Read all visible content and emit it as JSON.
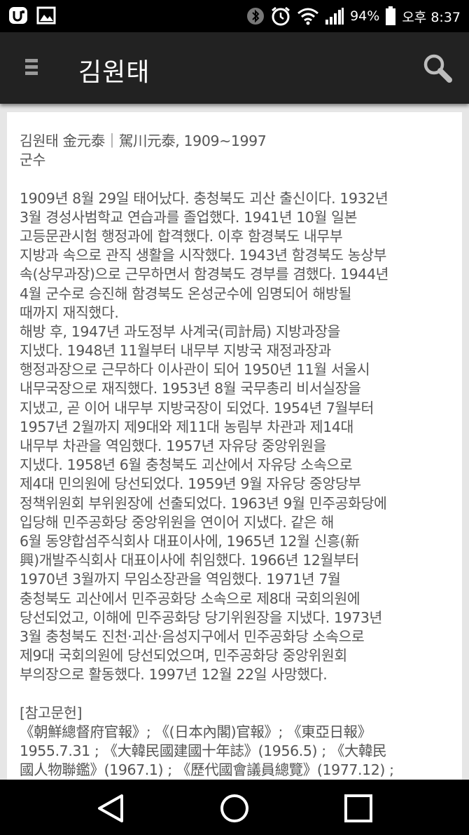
{
  "status_bar": {
    "battery": "94%",
    "time": "오후 8:37",
    "icons": [
      "u-plus-icon",
      "gallery-icon",
      "bluetooth-icon",
      "alarm-icon",
      "wifi-icon",
      "signal-icon",
      "battery-icon"
    ]
  },
  "app_bar": {
    "title": "김원태",
    "menu_icon": "hamburger-menu-icon",
    "search_icon": "search-icon"
  },
  "article": {
    "lines": [
      "김원태 金元泰｜駕川元泰, 1909~1997",
      "군수",
      "",
      "1909년 8월 29일 태어났다. 충청북도 괴산 출신이다. 1932년",
      "3월 경성사범학교 연습과를 졸업했다. 1941년 10월 일본",
      "고등문관시험 행정과에 합격했다. 이후 함경북도 내무부",
      "지방과 속으로 관직 생활을 시작했다. 1943년 함경북도 농상부",
      "속(상무과장)으로 근무하면서 함경북도 경부를 겸했다. 1944년",
      "4월 군수로 승진해 함경북도 온성군수에 임명되어 해방될",
      "때까지 재직했다.",
      "해방 후, 1947년 과도정부 사계국(司計局) 지방과장을",
      "지냈다. 1948년 11월부터 내무부 지방국 재정과장과",
      "행정과장으로 근무하다 이사관이 되어 1950년 11월 서울시",
      "내무국장으로 재직했다. 1953년 8월 국무총리 비서실장을",
      "지냈고, 곧 이어 내무부 지방국장이 되었다. 1954년 7월부터",
      "1957년 2월까지 제9대와 제11대 농림부 차관과 제14대",
      "내무부 차관을 역임했다. 1957년 자유당 중앙위원을",
      "지냈다. 1958년 6월 충청북도 괴산에서 자유당 소속으로",
      "제4대 민의원에 당선되었다. 1959년 9월 자유당 중앙당부",
      "정책위원회 부위원장에 선출되었다. 1963년 9월 민주공화당에",
      "입당해 민주공화당 중앙위원을 연이어 지냈다. 같은 해",
      "6월 동양합섬주식회사 대표이사에, 1965년 12월 신흥(新",
      "興)개발주식회사 대표이사에 취임했다. 1966년 12월부터",
      "1970년 3월까지 무임소장관을 역임했다. 1971년 7월",
      "충청북도 괴산에서 민주공화당 소속으로 제8대 국회의원에",
      "당선되었고, 이해에 민주공화당 당기위원장을 지냈다. 1973년",
      "3월 충청북도 진천·괴산·음성지구에서 민주공화당 소속으로",
      "제9대 국회의원에 당선되었으며, 민주공화당 중앙위원회",
      "부의장으로 활동했다. 1997년 12월 22일 사망했다.",
      "",
      "[참고문헌]",
      "《朝鮮總督府官報》; 《(日本內閣)官報》; 《東亞日報》",
      "1955.7.31 ; 《大韓民國建國十年誌》(1956.5) ; 《大韓民",
      "國人物聯鑑》(1967.1) ; 《歷代國會議員總覽》(1977.12) ;"
    ]
  },
  "nav_bar": {
    "back_icon": "back-triangle-icon",
    "home_icon": "home-circle-icon",
    "recents_icon": "recents-square-icon"
  }
}
